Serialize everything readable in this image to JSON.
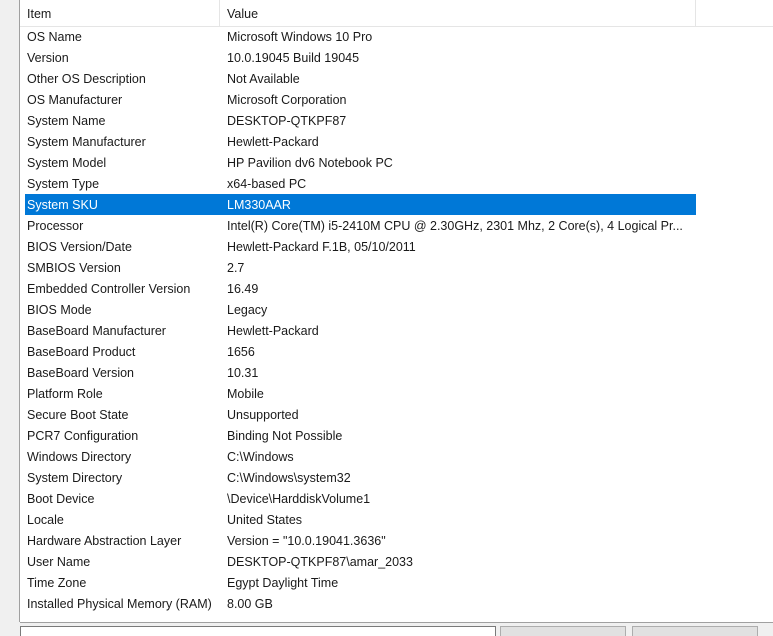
{
  "header": {
    "item_label": "Item",
    "value_label": "Value"
  },
  "rows": [
    {
      "item": "OS Name",
      "value": "Microsoft Windows 10 Pro"
    },
    {
      "item": "Version",
      "value": "10.0.19045 Build 19045"
    },
    {
      "item": "Other OS Description",
      "value": "Not Available"
    },
    {
      "item": "OS Manufacturer",
      "value": "Microsoft Corporation"
    },
    {
      "item": "System Name",
      "value": "DESKTOP-QTKPF87"
    },
    {
      "item": "System Manufacturer",
      "value": "Hewlett-Packard"
    },
    {
      "item": "System Model",
      "value": "HP Pavilion dv6 Notebook PC"
    },
    {
      "item": "System Type",
      "value": "x64-based PC"
    },
    {
      "item": "System SKU",
      "value": "LM330AAR"
    },
    {
      "item": "Processor",
      "value": "Intel(R) Core(TM) i5-2410M CPU @ 2.30GHz, 2301 Mhz, 2 Core(s), 4 Logical Pr..."
    },
    {
      "item": "BIOS Version/Date",
      "value": "Hewlett-Packard F.1B, 05/10/2011"
    },
    {
      "item": "SMBIOS Version",
      "value": "2.7"
    },
    {
      "item": "Embedded Controller Version",
      "value": "16.49"
    },
    {
      "item": "BIOS Mode",
      "value": "Legacy"
    },
    {
      "item": "BaseBoard Manufacturer",
      "value": "Hewlett-Packard"
    },
    {
      "item": "BaseBoard Product",
      "value": "1656"
    },
    {
      "item": "BaseBoard Version",
      "value": "10.31"
    },
    {
      "item": "Platform Role",
      "value": "Mobile"
    },
    {
      "item": "Secure Boot State",
      "value": "Unsupported"
    },
    {
      "item": "PCR7 Configuration",
      "value": "Binding Not Possible"
    },
    {
      "item": "Windows Directory",
      "value": "C:\\Windows"
    },
    {
      "item": "System Directory",
      "value": "C:\\Windows\\system32"
    },
    {
      "item": "Boot Device",
      "value": "\\Device\\HarddiskVolume1"
    },
    {
      "item": "Locale",
      "value": "United States"
    },
    {
      "item": "Hardware Abstraction Layer",
      "value": "Version = \"10.0.19041.3636\""
    },
    {
      "item": "User Name",
      "value": "DESKTOP-QTKPF87\\amar_2033"
    },
    {
      "item": "Time Zone",
      "value": "Egypt Daylight Time"
    },
    {
      "item": "Installed Physical Memory (RAM)",
      "value": "8.00 GB"
    }
  ],
  "selected_row_index": 8,
  "colors": {
    "selection": "#0078d7",
    "background": "#ffffff",
    "chrome": "#f0f0f0"
  }
}
